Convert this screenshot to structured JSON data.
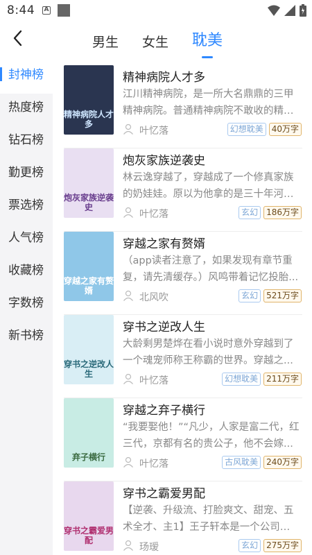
{
  "status_bar": {
    "time": "8:44"
  },
  "header": {
    "tabs": [
      {
        "label": "男生"
      },
      {
        "label": "女生"
      },
      {
        "label": "耽美"
      }
    ]
  },
  "sidebar": {
    "items": [
      {
        "label": "封神榜"
      },
      {
        "label": "热度榜"
      },
      {
        "label": "钻石榜"
      },
      {
        "label": "勤更榜"
      },
      {
        "label": "票选榜"
      },
      {
        "label": "人气榜"
      },
      {
        "label": "收藏榜"
      },
      {
        "label": "字数榜"
      },
      {
        "label": "新书榜"
      }
    ]
  },
  "books": [
    {
      "title": "精神病院人才多",
      "desc": "江川精神病院，是一所大名鼎鼎的三甲精神病院。普通精神病院不敢收的精神病...",
      "author": "叶忆落",
      "tag": "幻想耽美",
      "words": "40万字",
      "cover_text": "精神病院人才多",
      "cover_bg": "#2a3550",
      "cover_fg": "#cfe6ff"
    },
    {
      "title": "炮灰家族逆袭史",
      "desc": "林云逸穿越了，穿越成了一个修真家族的奶娃娃。原以为他拿的是三十年河东...",
      "author": "叶忆落",
      "tag": "玄幻",
      "words": "186万字",
      "cover_text": "炮灰家族逆袭史",
      "cover_bg": "#e9dff2",
      "cover_fg": "#6a3f8e"
    },
    {
      "title": "穿越之家有赘婿",
      "desc": "（app读者注意了，如果发现有章节重复，请先清缓存。）风鸣带着记忆投胎...",
      "author": "北风吹",
      "tag": "玄幻",
      "words": "521万字",
      "cover_text": "穿越之家有赘婿",
      "cover_bg": "#8fc7e8",
      "cover_fg": "#ffffff"
    },
    {
      "title": "穿书之逆改人生",
      "desc": "大龄剩男楚烨在看小说时意外穿越到了一个魂宠师称王称霸的世界。穿越之...",
      "author": "叶忆落",
      "tag": "幻想耽美",
      "words": "211万字",
      "cover_text": "穿书之逆改人生",
      "cover_bg": "#d9eef5",
      "cover_fg": "#2b6a7a"
    },
    {
      "title": "穿越之弃子横行",
      "desc": "“我要娶他！”“凡少，人家是富二代，红三代，京都有名的贵公子，他不会嫁...",
      "author": "叶忆落",
      "tag": "古风耽美",
      "words": "240万字",
      "cover_text": "弃子横行",
      "cover_bg": "#c8ece4",
      "cover_fg": "#3a6a40"
    },
    {
      "title": "穿书之霸爱男配",
      "desc": "【逆袭、升级流、打脸爽文、甜宠、五术全才、主1】王子轩本是一个公司小...",
      "author": "玚瑷",
      "tag": "玄幻",
      "words": "275万字",
      "cover_text": "穿书之霸爱男配",
      "cover_bg": "#e8d8ee",
      "cover_fg": "#b03070"
    }
  ],
  "colors": {
    "accent": "#2e88ff",
    "tag_border": "#a9c9ef",
    "words_border": "#e0b46a"
  }
}
